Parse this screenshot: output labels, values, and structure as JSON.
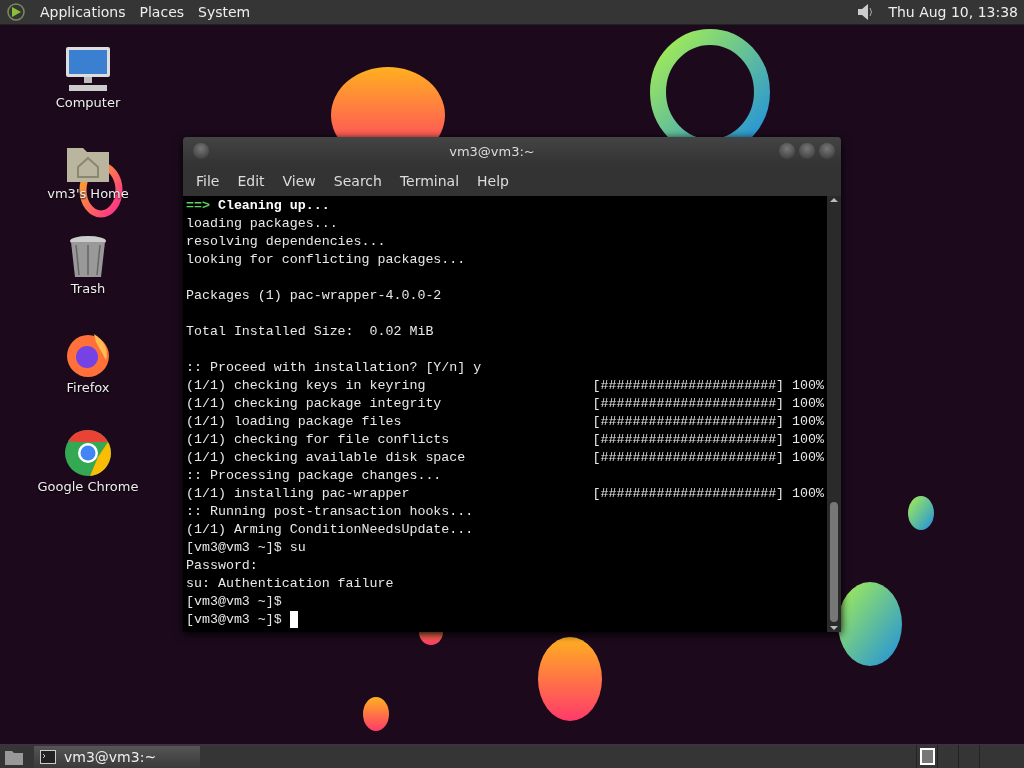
{
  "top_panel": {
    "menus": [
      "Applications",
      "Places",
      "System"
    ],
    "clock": "Thu Aug 10, 13:38"
  },
  "desktop_icons": [
    {
      "kind": "computer",
      "label": "Computer"
    },
    {
      "kind": "home",
      "label": "vm3's Home"
    },
    {
      "kind": "trash",
      "label": "Trash"
    },
    {
      "kind": "firefox",
      "label": "Firefox"
    },
    {
      "kind": "chrome",
      "label": "Google Chrome"
    }
  ],
  "terminal": {
    "title": "vm3@vm3:~",
    "menus": [
      "File",
      "Edit",
      "View",
      "Search",
      "Terminal",
      "Help"
    ],
    "lines": [
      {
        "kind": "header",
        "arrow": "==>",
        "text": "Cleaning up..."
      },
      {
        "kind": "text",
        "text": "loading packages..."
      },
      {
        "kind": "text",
        "text": "resolving dependencies..."
      },
      {
        "kind": "text",
        "text": "looking for conflicting packages..."
      },
      {
        "kind": "blank"
      },
      {
        "kind": "text",
        "text": "Packages (1) pac-wrapper-4.0.0-2"
      },
      {
        "kind": "blank"
      },
      {
        "kind": "text",
        "text": "Total Installed Size:  0.02 MiB"
      },
      {
        "kind": "blank"
      },
      {
        "kind": "text",
        "text": ":: Proceed with installation? [Y/n] y"
      },
      {
        "kind": "progress",
        "text": "(1/1) checking keys in keyring",
        "bar": "[######################] 100%"
      },
      {
        "kind": "progress",
        "text": "(1/1) checking package integrity",
        "bar": "[######################] 100%"
      },
      {
        "kind": "progress",
        "text": "(1/1) loading package files",
        "bar": "[######################] 100%"
      },
      {
        "kind": "progress",
        "text": "(1/1) checking for file conflicts",
        "bar": "[######################] 100%"
      },
      {
        "kind": "progress",
        "text": "(1/1) checking available disk space",
        "bar": "[######################] 100%"
      },
      {
        "kind": "text",
        "text": ":: Processing package changes..."
      },
      {
        "kind": "progress",
        "text": "(1/1) installing pac-wrapper",
        "bar": "[######################] 100%"
      },
      {
        "kind": "text",
        "text": ":: Running post-transaction hooks..."
      },
      {
        "kind": "text",
        "text": "(1/1) Arming ConditionNeedsUpdate..."
      },
      {
        "kind": "text",
        "text": "[vm3@vm3 ~]$ su"
      },
      {
        "kind": "text",
        "text": "Password:"
      },
      {
        "kind": "text",
        "text": "su: Authentication failure"
      },
      {
        "kind": "text",
        "text": "[vm3@vm3 ~]$"
      },
      {
        "kind": "prompt",
        "text": "[vm3@vm3 ~]$"
      }
    ]
  },
  "taskbar": {
    "windows": [
      {
        "title": "vm3@vm3:~",
        "selected": true
      }
    ]
  }
}
